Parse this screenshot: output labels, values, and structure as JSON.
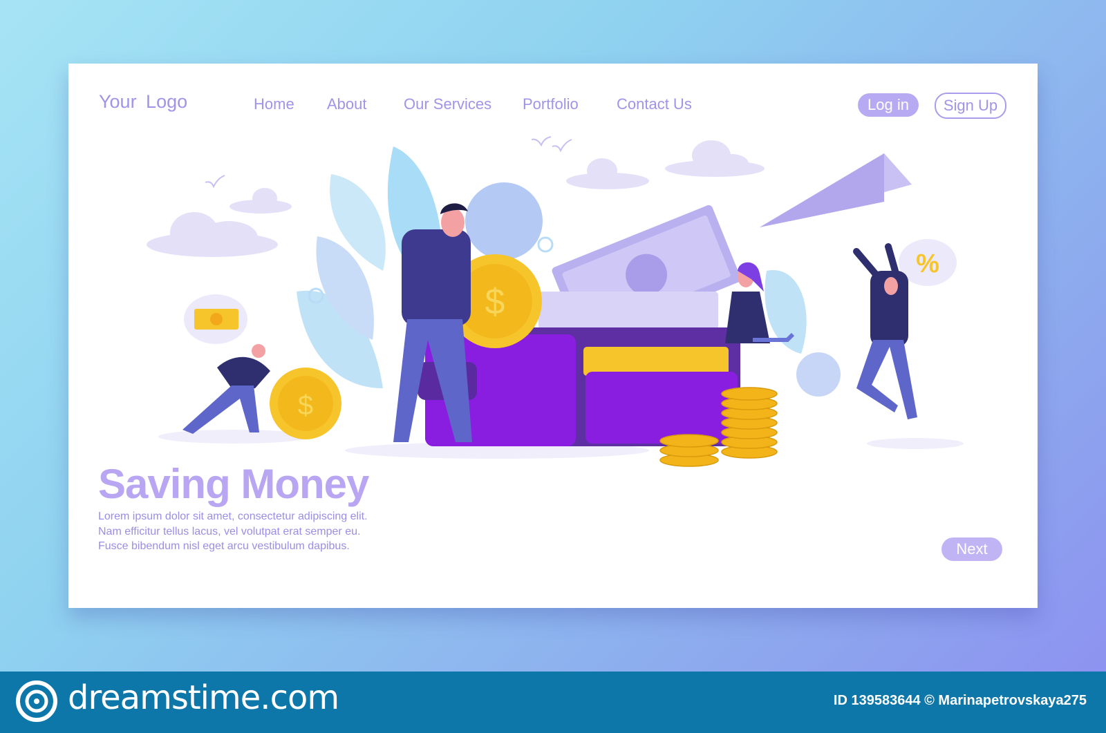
{
  "header": {
    "logo": "Your  Logo",
    "nav": [
      "Home",
      "About",
      "Our Services",
      "Portfolio",
      "Contact Us"
    ],
    "login_label": "Log in",
    "signup_label": "Sign Up"
  },
  "hero": {
    "title": "Saving Money",
    "body_lines": [
      "Lorem ipsum dolor sit amet, consectetur adipiscing elit.",
      "Nam efficitur tellus lacus, vel volutpat erat semper eu.",
      "Fusce bibendum nisl eget arcu vestibulum dapibus."
    ],
    "next_label": "Next"
  },
  "illustration": {
    "speech_bubble_symbol": "%",
    "coin_symbol": "$"
  },
  "footer": {
    "brand": "dreamstime.com",
    "credit": "ID 139583644 © Marinapetrovskaya275"
  },
  "colors": {
    "accent": "#9f94e8",
    "wallet": "#8a1ee0",
    "coin": "#f6c52c",
    "footer": "#0d77aa"
  }
}
